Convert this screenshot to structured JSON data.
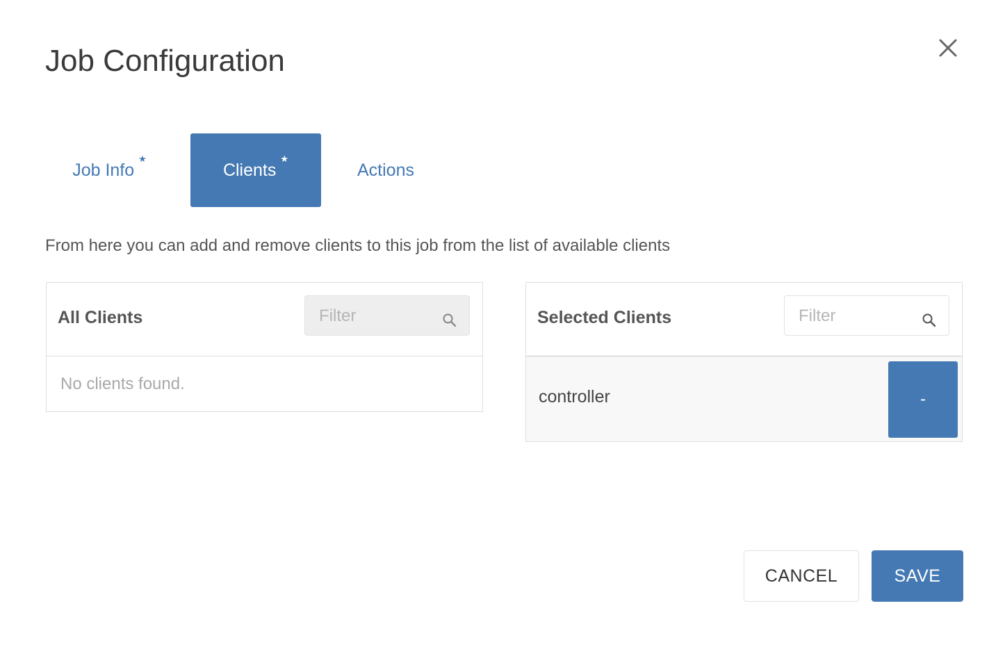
{
  "dialog": {
    "title": "Job Configuration",
    "close_icon": "close-icon"
  },
  "tabs": [
    {
      "label": "Job Info",
      "required_marker": "★",
      "active": false
    },
    {
      "label": "Clients",
      "required_marker": "★",
      "active": true
    },
    {
      "label": "Actions",
      "required_marker": "",
      "active": false
    }
  ],
  "description": "From here you can add and remove clients to this job from the list of available clients",
  "all_clients": {
    "title": "All Clients",
    "filter_placeholder": "Filter",
    "empty_message": "No clients found."
  },
  "selected_clients": {
    "title": "Selected Clients",
    "filter_placeholder": "Filter",
    "items": [
      {
        "name": "controller",
        "remove_label": "-"
      }
    ]
  },
  "footer": {
    "cancel_label": "CANCEL",
    "save_label": "SAVE"
  },
  "colors": {
    "accent": "#4579b3",
    "text": "#333333",
    "muted": "#a8a8a8",
    "border": "#dddddd"
  }
}
